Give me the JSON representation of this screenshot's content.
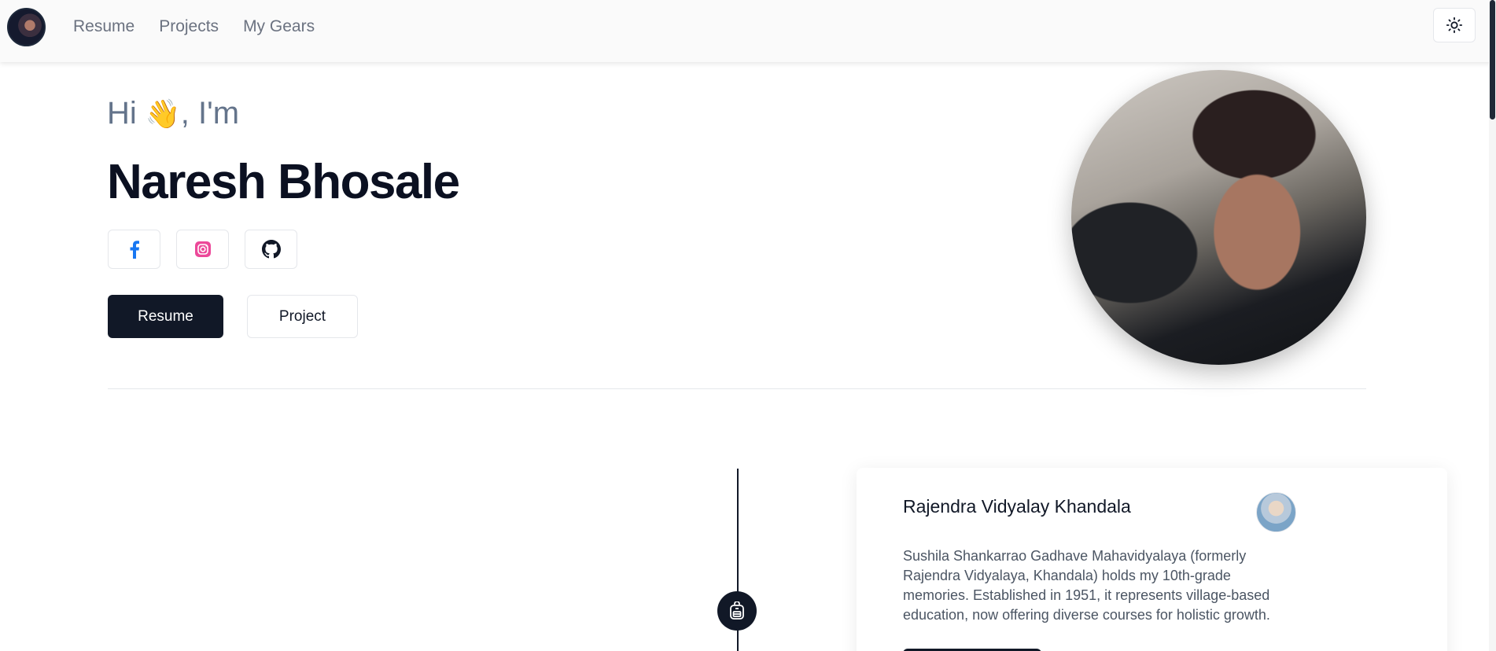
{
  "header": {
    "avatar_alt": "profile avatar",
    "nav": [
      {
        "label": "Resume"
      },
      {
        "label": "Projects"
      },
      {
        "label": "My Gears"
      }
    ],
    "theme_icon": "sun-icon"
  },
  "hero": {
    "greeting_prefix": "Hi",
    "greeting_emoji": "👋",
    "greeting_suffix": ", I'm",
    "name": "Naresh Bhosale",
    "socials": [
      {
        "name": "facebook-icon",
        "color": "#1877f2"
      },
      {
        "name": "instagram-icon",
        "color": "#ec4899"
      },
      {
        "name": "github-icon",
        "color": "#111827"
      }
    ],
    "primary_button": "Resume",
    "secondary_button": "Project"
  },
  "timeline": {
    "dot_icon": "backpack-icon",
    "card": {
      "title": "Rajendra Vidyalay Khandala",
      "description": "Sushila Shankarrao Gadhave Mahavidyalaya (formerly Rajendra Vidyalaya, Khandala) holds my 10th-grade memories. Established in 1951, it represents village-based education, now offering diverse courses for holistic growth."
    }
  },
  "colors": {
    "primary": "#111827",
    "muted_text": "#64748b",
    "facebook": "#1877f2",
    "instagram": "#ec4899"
  }
}
